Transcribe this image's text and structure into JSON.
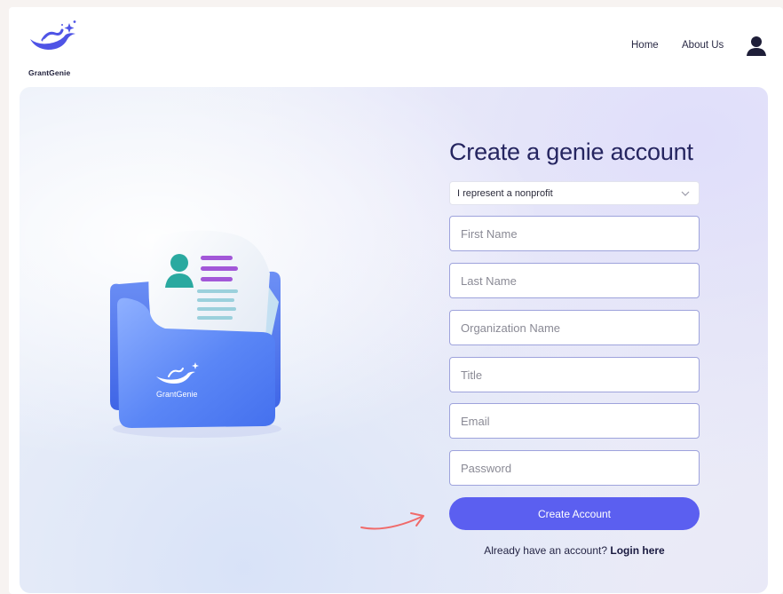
{
  "brand": {
    "name": "GrantGenie",
    "logo_icon": "genie-lamp-icon",
    "color": "#5b5ff0"
  },
  "nav": {
    "items": [
      {
        "label": "Home"
      },
      {
        "label": "About Us"
      }
    ],
    "user_icon": "user-icon"
  },
  "illustration": {
    "icon": "folder-document-icon",
    "folder_label": "GrantGenie"
  },
  "form": {
    "title": "Create a genie account",
    "role_select": {
      "selected": "I represent a nonprofit",
      "icon": "chevron-down-icon"
    },
    "fields": {
      "first_name": {
        "placeholder": "First Name"
      },
      "last_name": {
        "placeholder": "Last Name"
      },
      "organization": {
        "placeholder": "Organization Name"
      },
      "title": {
        "placeholder": "Title"
      },
      "email": {
        "placeholder": "Email"
      },
      "password": {
        "placeholder": "Password"
      }
    },
    "submit_label": "Create Account",
    "login_prompt": "Already have an account?",
    "login_link": "Login here"
  },
  "colors": {
    "accent": "#5b5ff0",
    "field_border": "#9ea3dc",
    "title_text": "#252560",
    "arrow": "#f06a6a"
  }
}
